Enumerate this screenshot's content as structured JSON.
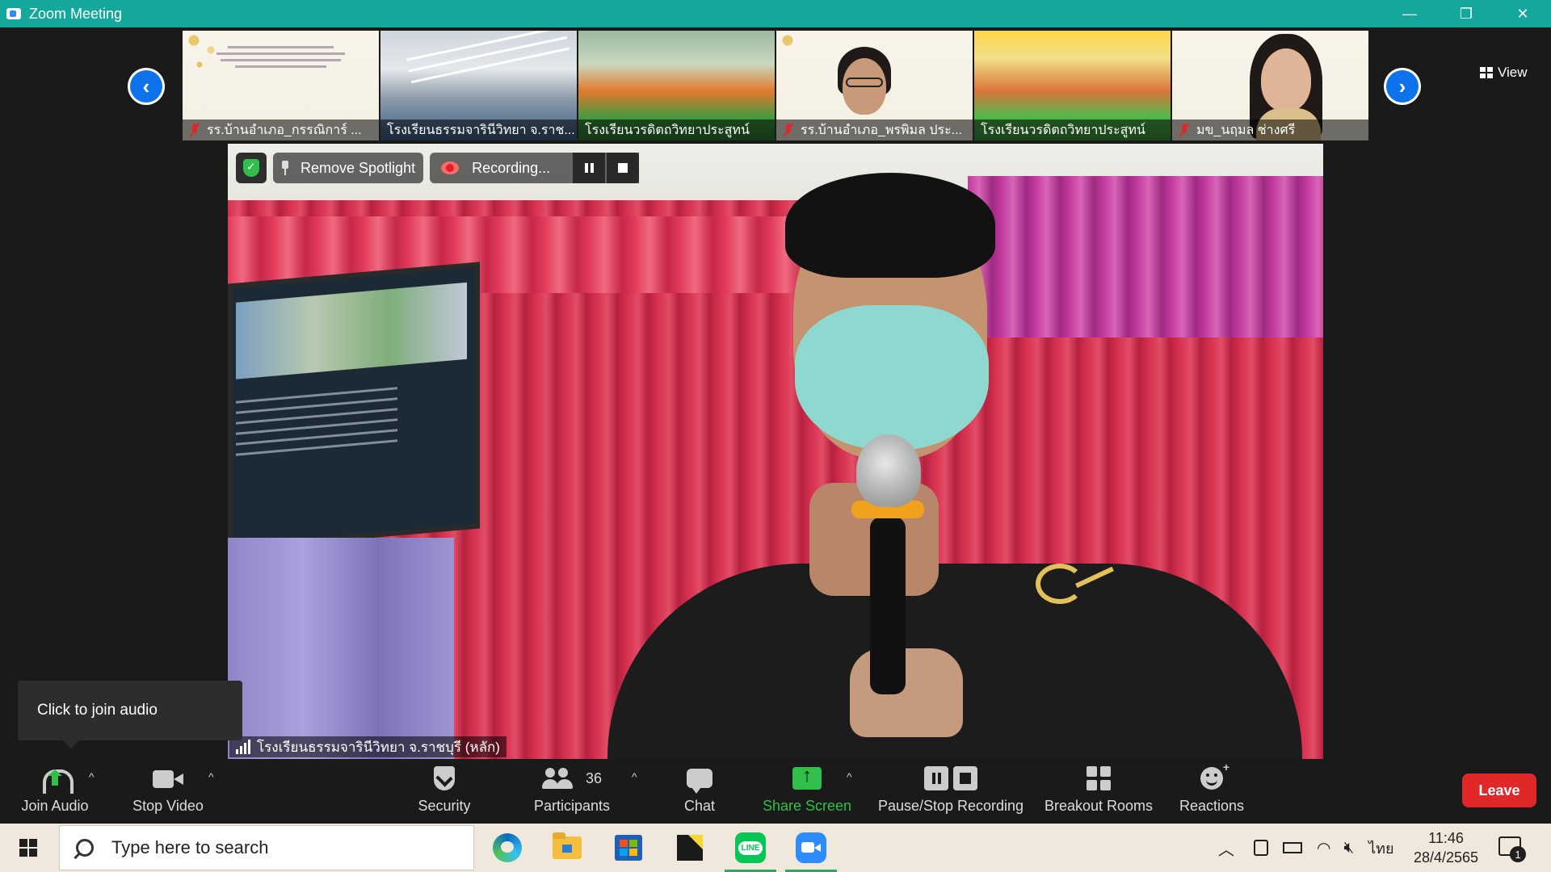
{
  "window": {
    "title": "Zoom Meeting",
    "controls": [
      "—",
      "❐",
      "✕"
    ]
  },
  "strip": {
    "view_label": "View",
    "thumbnails": [
      {
        "label": "รร.บ้านอำเภอ_กรรณิการ์ ...",
        "muted": true,
        "kind": "slide"
      },
      {
        "label": "โรงเรียนธรรมจารินีวิทยา จ.ราช...",
        "muted": false,
        "kind": "hall"
      },
      {
        "label": "โรงเรียนวรดิตถวิทยาประสูทน์",
        "muted": false,
        "kind": "class"
      },
      {
        "label": "รร.บ้านอำเภอ_พรพิมล ประ...",
        "muted": true,
        "kind": "face-glasses"
      },
      {
        "label": "โรงเรียนวรดิตถวิทยาประสูทน์",
        "muted": false,
        "kind": "class2"
      },
      {
        "label": "มข_นฤมล ช่างศรี",
        "muted": true,
        "kind": "face"
      }
    ]
  },
  "spotlight": {
    "remove_label": "Remove Spotlight",
    "recording_label": "Recording..."
  },
  "main_video": {
    "name_tag": "โรงเรียนธรรมจารินีวิทยา จ.ราชบุรี (หลัก)"
  },
  "tooltip": {
    "text": "Click to join audio"
  },
  "toolbar": {
    "join_audio": "Join Audio",
    "stop_video": "Stop Video",
    "security": "Security",
    "participants": "Participants",
    "participants_count": "36",
    "chat": "Chat",
    "share_screen": "Share Screen",
    "pause_stop_recording": "Pause/Stop Recording",
    "breakout_rooms": "Breakout Rooms",
    "reactions": "Reactions",
    "leave": "Leave",
    "share_color": "#2fbf4a",
    "leave_color": "#e02828"
  },
  "taskbar": {
    "search_placeholder": "Type here to search",
    "apps": [
      "edge-icon",
      "file-explorer-icon",
      "store-icon",
      "sticky-notes-icon",
      "line-icon",
      "zoom-icon"
    ],
    "line_label": "LINE",
    "tray_lang": "ไทย",
    "time": "11:46",
    "date": "28/4/2565",
    "notification_count": "1"
  }
}
